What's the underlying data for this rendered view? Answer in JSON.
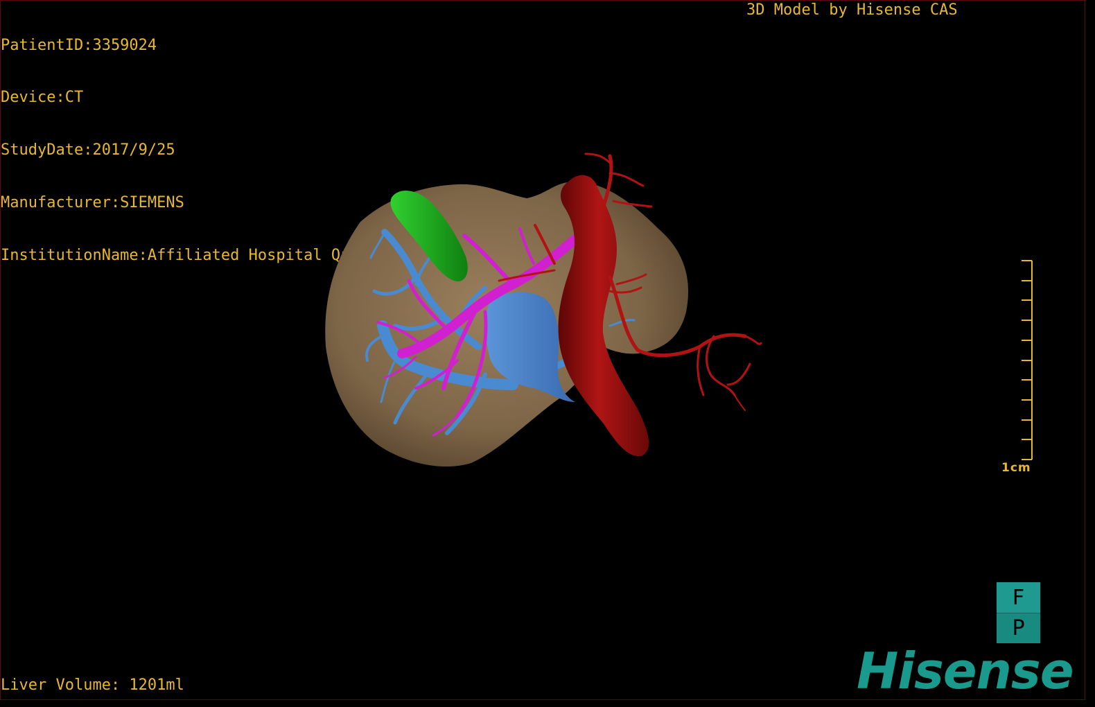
{
  "header": {
    "patient_id": "PatientID:3359024",
    "device": "Device:CT",
    "study_date": "StudyDate:2017/9/25",
    "manufacturer": "Manufacturer:SIEMENS",
    "institution": "InstitutionName:Affiliated Hospital Qingdao University-C"
  },
  "credit": "3D Model by Hisense CAS",
  "footer": {
    "liver_volume": "Liver Volume: 1201ml"
  },
  "scale_bar": {
    "label": "1cm"
  },
  "orientation": {
    "top": "F",
    "bottom": "P"
  },
  "logo": {
    "text": "Hisense"
  },
  "colors": {
    "overlay_text": "#e8b830",
    "liver": "#8a7050",
    "portal_vein": "#4a8ad0",
    "hepatic_vein": "#d020d0",
    "gallbladder": "#20b020",
    "aorta": "#a01010",
    "brand": "#1a9a8c"
  }
}
